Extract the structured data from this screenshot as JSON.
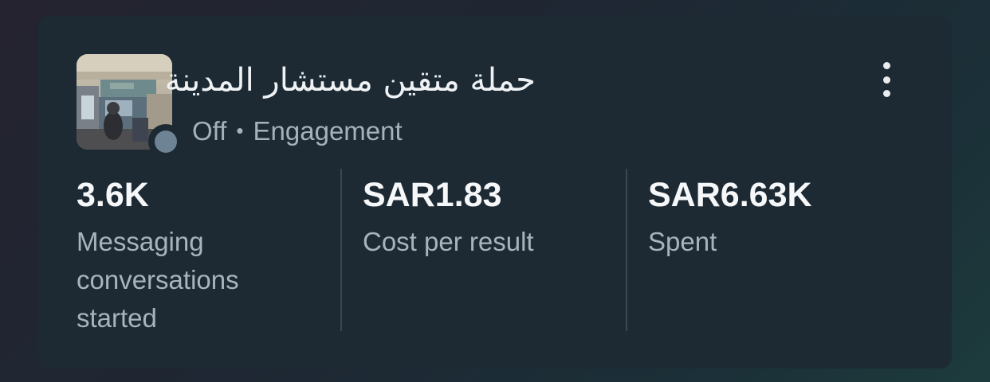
{
  "campaign": {
    "title": "حملة متقين مستشار المدينة",
    "status": "Off",
    "separator": "•",
    "objective": "Engagement",
    "status_color": "#6e8394",
    "thumbnail": "campaign-photo",
    "menu_icon": "more-vertical-icon"
  },
  "metrics": [
    {
      "value": "3.6K",
      "label": "Messaging conversations started"
    },
    {
      "value": "SAR1.83",
      "label": "Cost per result"
    },
    {
      "value": "SAR6.63K",
      "label": "Spent"
    }
  ]
}
